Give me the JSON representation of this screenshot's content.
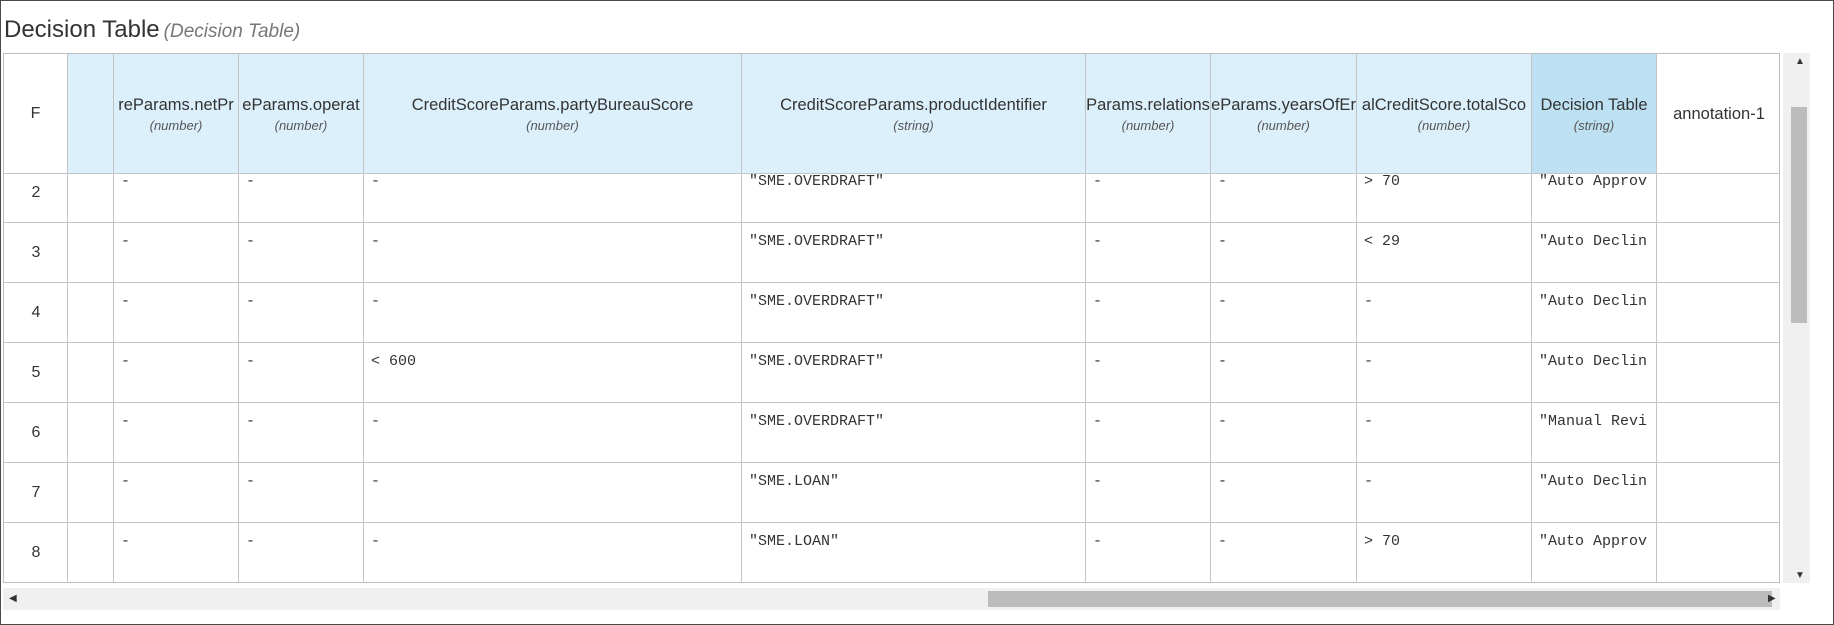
{
  "title": {
    "main": "Decision Table",
    "sub": "(Decision Table)"
  },
  "header": {
    "index_label": "F",
    "columns": [
      {
        "name": "",
        "type": ""
      },
      {
        "name": "reParams.netPr",
        "type": "(number)"
      },
      {
        "name": "eParams.operat",
        "type": "(number)"
      },
      {
        "name": "CreditScoreParams.partyBureauScore",
        "type": "(number)"
      },
      {
        "name": "CreditScoreParams.productIdentifier",
        "type": "(string)"
      },
      {
        "name": "Params.relations",
        "type": "(number)"
      },
      {
        "name": "eParams.yearsOfEr",
        "type": "(number)"
      },
      {
        "name": "alCreditScore.totalSco",
        "type": "(number)"
      },
      {
        "name": "Decision Table",
        "type": "(string)"
      },
      {
        "name": "annotation-1",
        "type": ""
      }
    ]
  },
  "rows": [
    {
      "index": "2",
      "cells": [
        "",
        "-",
        "-",
        "-",
        "\"SME.OVERDRAFT\"",
        "-",
        "-",
        "> 70",
        "\"Auto Approv",
        ""
      ]
    },
    {
      "index": "3",
      "cells": [
        "",
        "-",
        "-",
        "-",
        "\"SME.OVERDRAFT\"",
        "-",
        "-",
        "< 29",
        "\"Auto Declin",
        ""
      ]
    },
    {
      "index": "4",
      "cells": [
        "",
        "-",
        "-",
        "-",
        "\"SME.OVERDRAFT\"",
        "-",
        "-",
        "-",
        "\"Auto Declin",
        ""
      ]
    },
    {
      "index": "5",
      "cells": [
        "",
        "-",
        "-",
        "< 600",
        "\"SME.OVERDRAFT\"",
        "-",
        "-",
        "-",
        "\"Auto Declin",
        ""
      ]
    },
    {
      "index": "6",
      "cells": [
        "",
        "-",
        "-",
        "-",
        "\"SME.OVERDRAFT\"",
        "-",
        "-",
        "-",
        "\"Manual Revi",
        ""
      ]
    },
    {
      "index": "7",
      "cells": [
        "",
        "-",
        "-",
        "-",
        "\"SME.LOAN\"",
        "-",
        "-",
        "-",
        "\"Auto Declin",
        ""
      ]
    },
    {
      "index": "8",
      "cells": [
        "",
        "-",
        "-",
        "-",
        "\"SME.LOAN\"",
        "-",
        "-",
        "> 70",
        "\"Auto Approv",
        ""
      ]
    }
  ],
  "scrollbars": {
    "up_icon": "arrow-up-icon",
    "down_icon": "arrow-down-icon",
    "left_icon": "arrow-left-icon",
    "right_icon": "arrow-right-icon"
  },
  "colors": {
    "header_bg": "#dcf0fb",
    "output_header_bg": "#bde1f3",
    "grid_line": "#c4c4c4"
  }
}
